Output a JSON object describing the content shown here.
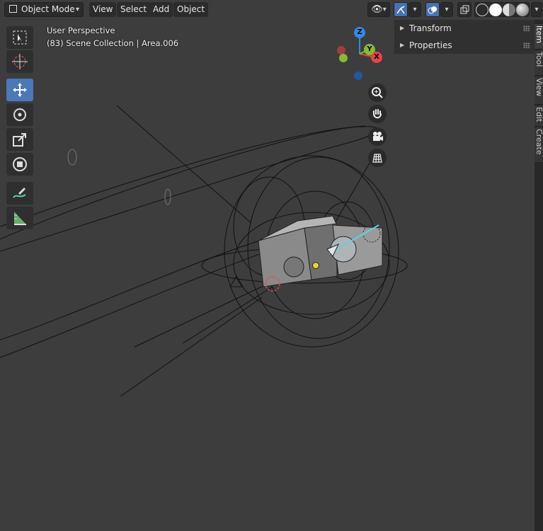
{
  "header": {
    "mode_label": "Object Mode",
    "menus": [
      "View",
      "Select",
      "Add",
      "Object"
    ],
    "shading_modes": [
      "wireframe",
      "solid",
      "material-preview",
      "rendered"
    ],
    "active_shading": "solid"
  },
  "overlay": {
    "perspective": "User Perspective",
    "collection": "(83) Scene Collection | Area.006"
  },
  "gizmo": {
    "z_label": "Z",
    "y_label": "Y",
    "x_label": "X",
    "colors": {
      "x": "#e8434b",
      "y": "#84bb31",
      "z": "#2f8ce6"
    }
  },
  "tools": [
    {
      "name": "select-box",
      "active": false
    },
    {
      "name": "cursor",
      "active": false
    },
    {
      "name": "move",
      "active": true
    },
    {
      "name": "rotate",
      "active": false
    },
    {
      "name": "scale",
      "active": false
    },
    {
      "name": "transform",
      "active": false
    },
    {
      "name": "annotate",
      "active": false
    },
    {
      "name": "measure",
      "active": false
    }
  ],
  "navigation": [
    "zoom-icon",
    "hand-icon",
    "camera-icon",
    "grid-icon"
  ],
  "sidebar": {
    "panels": [
      {
        "label": "Transform",
        "expanded": false
      },
      {
        "label": "Properties",
        "expanded": false
      }
    ],
    "tabs": [
      {
        "label": "Item",
        "active": true
      },
      {
        "label": "Tool",
        "active": false
      },
      {
        "label": "View",
        "active": false
      },
      {
        "label": "Edit",
        "active": false
      },
      {
        "label": "Create",
        "active": false
      }
    ]
  },
  "theme": {
    "viewport_bg": "#3d3d3d",
    "accent": "#4772b3"
  }
}
